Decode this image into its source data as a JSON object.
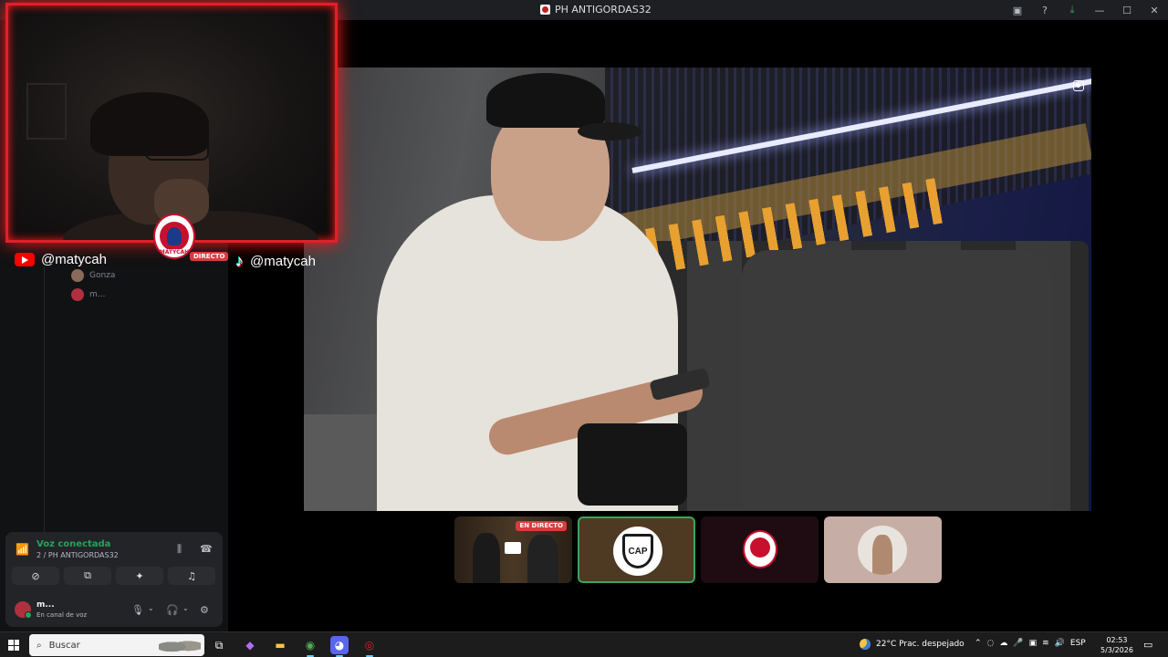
{
  "window": {
    "title": "PH ANTIGORDAS32",
    "controls": [
      "inbox-icon",
      "help-icon",
      "download-icon",
      "minimize-icon",
      "maximize-icon",
      "close-icon"
    ]
  },
  "overlay": {
    "youtube_handle": "@matycah",
    "tiktok_handle": "@matycah",
    "badge_name": "MATYCAH",
    "live_tag": "DIRECTO"
  },
  "voice_users": [
    {
      "name": "Gonza"
    },
    {
      "name": "m..."
    }
  ],
  "thumbnails": [
    {
      "live_label": "EN DIRECTO",
      "type": "stream"
    },
    {
      "label": "CAP",
      "type": "avatar",
      "selected": true
    },
    {
      "type": "avatar"
    },
    {
      "type": "avatar"
    }
  ],
  "voice_panel": {
    "status": "Voz conectada",
    "channel": "2 / PH ANTIGORDAS32",
    "user_name": "m...",
    "user_status": "En canal de voz"
  },
  "taskbar": {
    "search_placeholder": "Buscar",
    "weather": "22°C  Prac. despejado",
    "language": "ESP",
    "time": "02:53",
    "date": "5/3/2026"
  },
  "colors": {
    "discord_green": "#23a55a",
    "live_red": "#d83c3e",
    "webcam_border": "#e0202a"
  }
}
